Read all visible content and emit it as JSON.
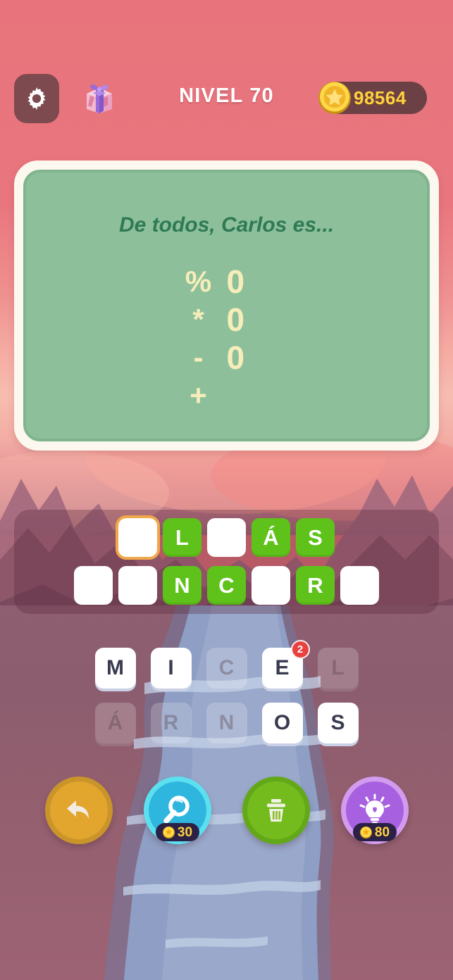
{
  "header": {
    "settings_icon": "gear-icon",
    "gift_icon": "gift-box-icon",
    "level_label": "NIVEL 70",
    "coin_icon": "star-coin-icon",
    "coin_amount": "98564"
  },
  "board": {
    "clue": "De todos, Carlos es...",
    "symbol_rows": [
      {
        "left": "%",
        "right": "0"
      },
      {
        "left": "*",
        "right": "0"
      },
      {
        "left": "-",
        "right": "0"
      },
      {
        "left": "+",
        "right": ""
      }
    ]
  },
  "answer": {
    "rows": [
      [
        {
          "letter": "",
          "state": "active"
        },
        {
          "letter": "L",
          "state": "filled"
        },
        {
          "letter": "",
          "state": "empty"
        },
        {
          "letter": "Á",
          "state": "filled"
        },
        {
          "letter": "S",
          "state": "filled"
        }
      ],
      [
        {
          "letter": "",
          "state": "empty"
        },
        {
          "letter": "",
          "state": "empty"
        },
        {
          "letter": "N",
          "state": "filled"
        },
        {
          "letter": "C",
          "state": "filled"
        },
        {
          "letter": "",
          "state": "empty"
        },
        {
          "letter": "R",
          "state": "filled"
        },
        {
          "letter": "",
          "state": "empty"
        }
      ]
    ]
  },
  "keyboard": {
    "rows": [
      [
        {
          "letter": "M",
          "state": "available",
          "badge": ""
        },
        {
          "letter": "I",
          "state": "available",
          "badge": ""
        },
        {
          "letter": "C",
          "state": "used",
          "badge": ""
        },
        {
          "letter": "E",
          "state": "available",
          "badge": "2"
        },
        {
          "letter": "L",
          "state": "used",
          "badge": ""
        }
      ],
      [
        {
          "letter": "Á",
          "state": "used",
          "badge": ""
        },
        {
          "letter": "R",
          "state": "used",
          "badge": ""
        },
        {
          "letter": "N",
          "state": "used",
          "badge": ""
        },
        {
          "letter": "O",
          "state": "available",
          "badge": ""
        },
        {
          "letter": "S",
          "state": "available",
          "badge": ""
        }
      ]
    ]
  },
  "actions": [
    {
      "name": "undo-button",
      "icon": "back-arrow-icon",
      "cost": ""
    },
    {
      "name": "search-button",
      "icon": "magnifier-icon",
      "cost": "30"
    },
    {
      "name": "clear-button",
      "icon": "trash-icon",
      "cost": ""
    },
    {
      "name": "hint-button",
      "icon": "lightbulb-icon",
      "cost": "80"
    }
  ],
  "colors": {
    "background_top": "#e8737c",
    "board_green": "#8dc09a",
    "clue_text": "#2f7a55",
    "tile_filled": "#5ec21a",
    "active_tile_border": "#f0a84a",
    "coin_gold": "#ffd23f",
    "badge_red": "#e8413f"
  }
}
